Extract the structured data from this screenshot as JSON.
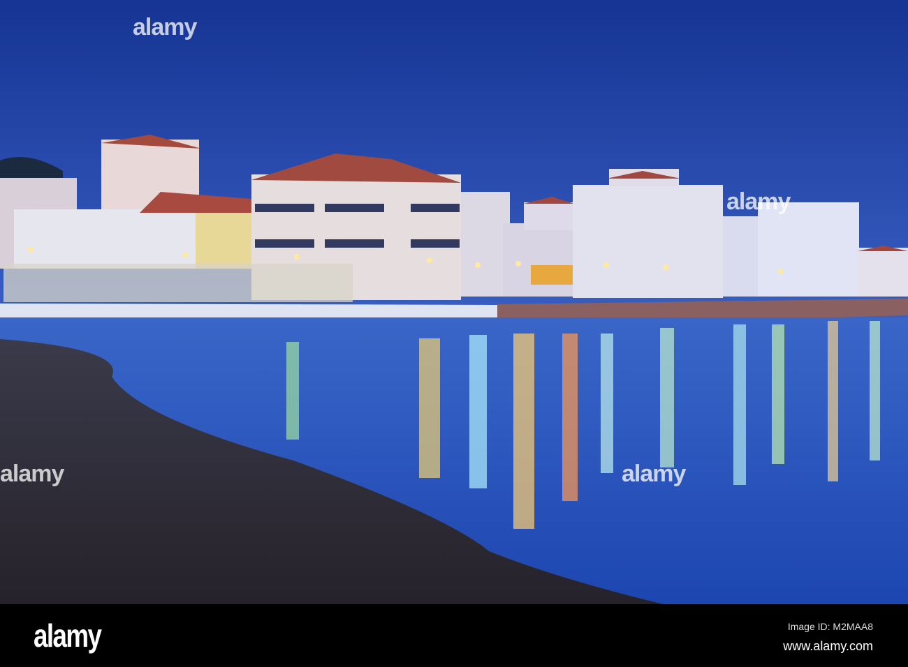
{
  "watermark": {
    "text": "alamy"
  },
  "footer": {
    "logo": "alamy",
    "image_id": "Image ID: M2MAA8",
    "website": "www.alamy.com"
  },
  "colors": {
    "sky_top": "#1a3a9a",
    "sky_bottom": "#2f56c0",
    "sea": "#2a55b8",
    "beach": "#2e2c38"
  }
}
